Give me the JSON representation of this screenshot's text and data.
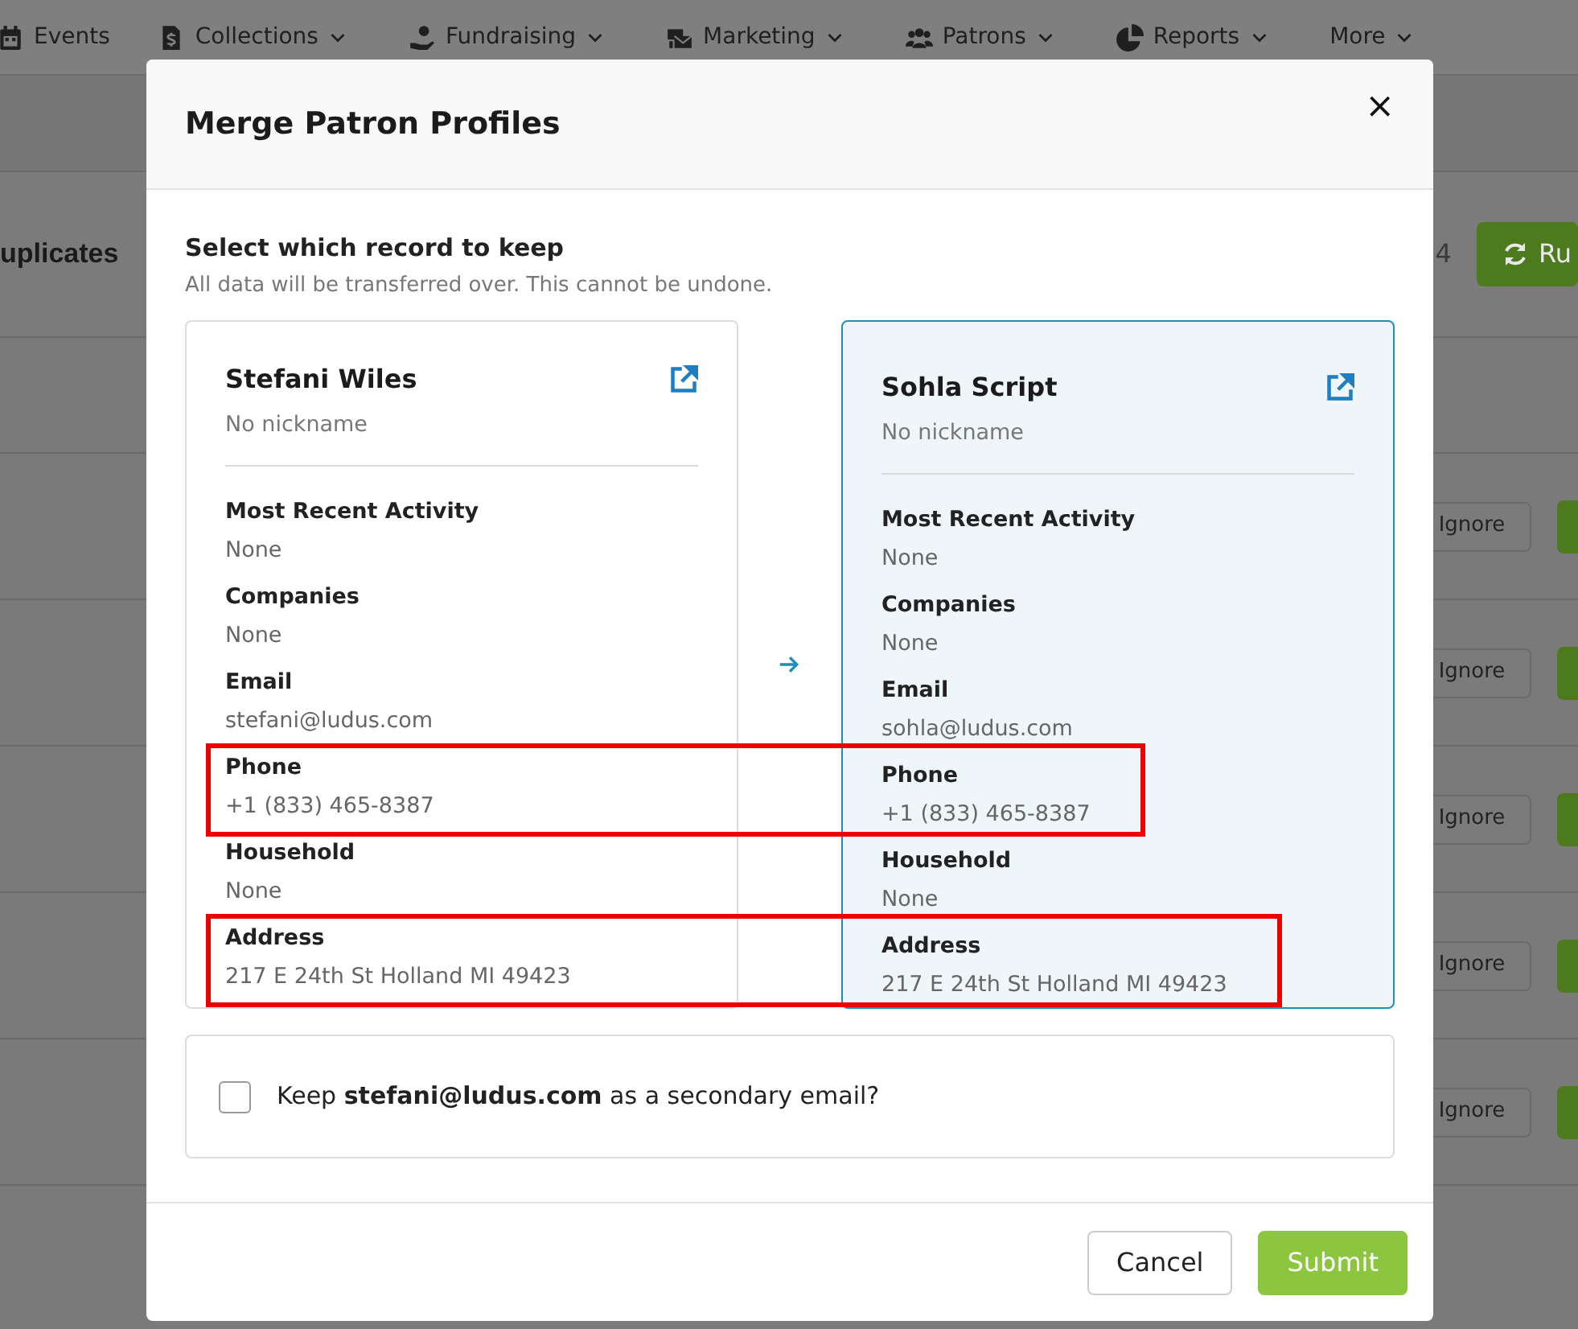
{
  "nav": {
    "items": [
      {
        "label": "Events",
        "dropdown": false
      },
      {
        "label": "Collections",
        "dropdown": true
      },
      {
        "label": "Fundraising",
        "dropdown": true
      },
      {
        "label": "Marketing",
        "dropdown": true
      },
      {
        "label": "Patrons",
        "dropdown": true
      },
      {
        "label": "Reports",
        "dropdown": true
      },
      {
        "label": "More",
        "dropdown": true
      }
    ]
  },
  "page": {
    "title": "uplicates",
    "count": "4",
    "run_button": "Ru",
    "rows": [
      {
        "action": "Ignore"
      },
      {
        "action": "Ignore"
      },
      {
        "action": "Ignore"
      },
      {
        "action": "Ignore"
      },
      {
        "action": "Ignore"
      }
    ]
  },
  "modal": {
    "title": "Merge Patron Profiles",
    "close": "×",
    "heading": "Select which record to keep",
    "subtitle": "All data will be transferred over. This cannot be undone.",
    "profiles": [
      {
        "name": "Stefani Wiles",
        "nickname": "No nickname",
        "selected": false,
        "fields": [
          {
            "label": "Most Recent Activity",
            "value": "None"
          },
          {
            "label": "Companies",
            "value": "None"
          },
          {
            "label": "Email",
            "value": "stefani@ludus.com"
          },
          {
            "label": "Phone",
            "value": "+1 (833) 465-8387",
            "highlighted": true
          },
          {
            "label": "Household",
            "value": "None"
          },
          {
            "label": "Address",
            "value": "217 E 24th St Holland MI 49423",
            "highlighted": true
          }
        ]
      },
      {
        "name": "Sohla Script",
        "nickname": "No nickname",
        "selected": true,
        "fields": [
          {
            "label": "Most Recent Activity",
            "value": "None"
          },
          {
            "label": "Companies",
            "value": "None"
          },
          {
            "label": "Email",
            "value": "sohla@ludus.com"
          },
          {
            "label": "Phone",
            "value": "+1 (833) 465-8387",
            "highlighted": true
          },
          {
            "label": "Household",
            "value": "None"
          },
          {
            "label": "Address",
            "value": "217 E 24th St Holland MI 49423",
            "highlighted": true
          }
        ]
      }
    ],
    "secondary_email": {
      "text": "Keep **stefani@ludus.com** as a secondary email?",
      "checked": false
    },
    "buttons": [
      {
        "label": "Cancel",
        "kind": "secondary"
      },
      {
        "label": "Submit",
        "kind": "primary"
      }
    ]
  }
}
